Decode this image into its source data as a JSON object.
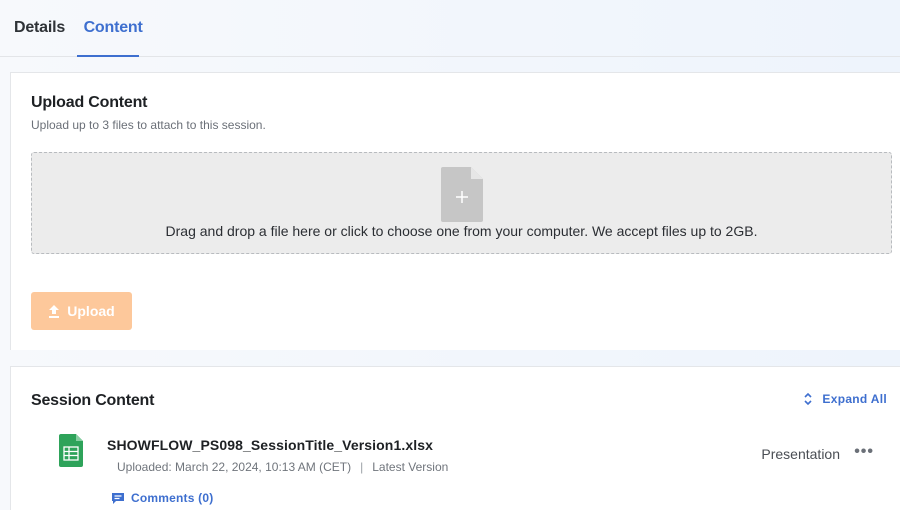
{
  "tabs": [
    {
      "label": "Details",
      "active": false
    },
    {
      "label": "Content",
      "active": true
    }
  ],
  "upload": {
    "title": "Upload Content",
    "subtitle": "Upload up to 3 files to attach to this session.",
    "dropzone_text": "Drag and drop a file here or click to choose one from your computer. We accept files up to 2GB.",
    "button_label": "Upload",
    "button_icon": "upload-arrow-icon",
    "dropzone_icon": "file-plus-icon"
  },
  "session_content": {
    "title": "Session Content",
    "expand_all_label": "Expand All",
    "files": [
      {
        "name": "SHOWFLOW_PS098_SessionTitle_Version1.xlsx",
        "uploaded": "Uploaded: March 22, 2024, 10:13 AM (CET)",
        "separator": "|",
        "version": "Latest Version",
        "type": "Presentation",
        "more_label": "•••",
        "comments_label": "Comments (0)",
        "icon": "spreadsheet-icon"
      }
    ]
  },
  "colors": {
    "accent": "#3e6fcf",
    "upload_button_disabled": "#fdc89b",
    "spreadsheet_green": "#2ea35a",
    "dropzone_bg": "#ececec"
  }
}
